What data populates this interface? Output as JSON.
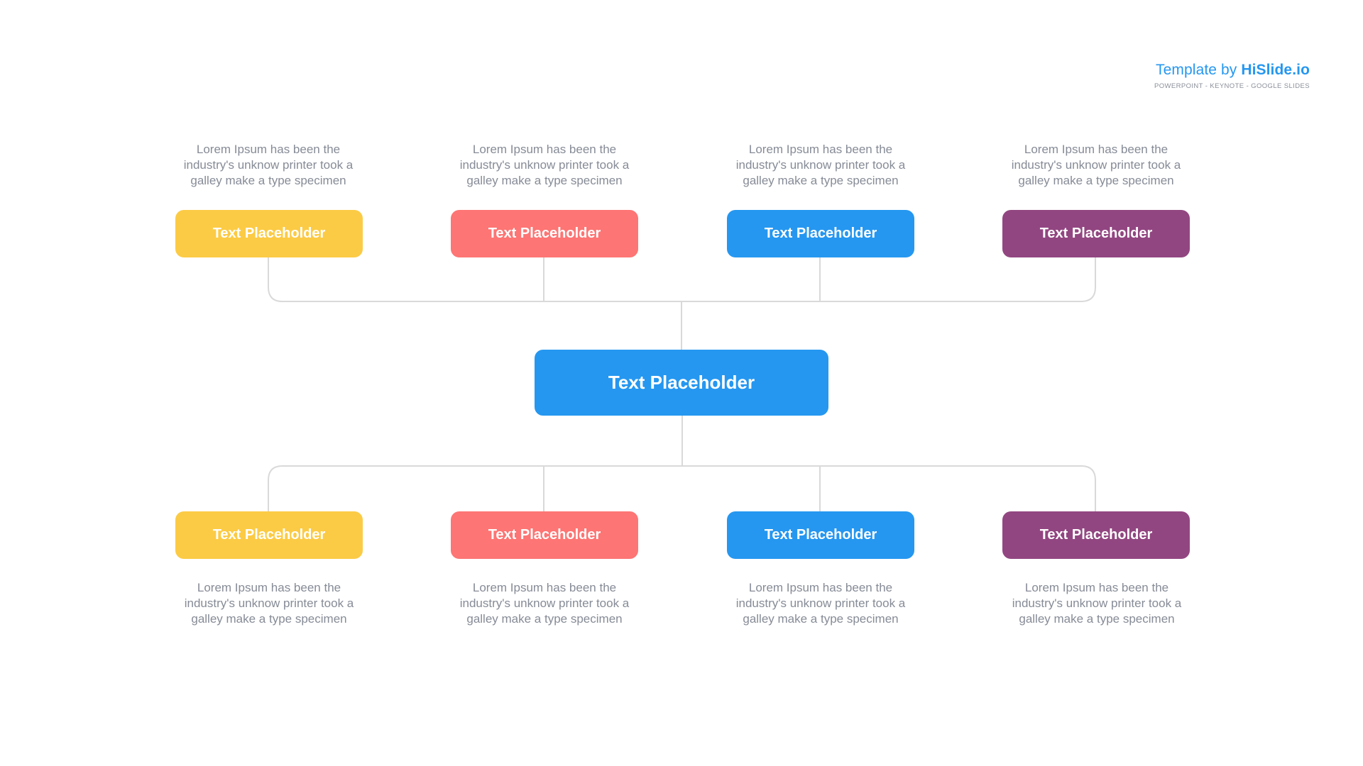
{
  "watermark": {
    "prefix": "Template by ",
    "brand": "HiSlide.io",
    "subtitle": "POWERPOINT - KEYNOTE - GOOGLE SLIDES"
  },
  "colors": {
    "yellow": "#fccb45",
    "coral": "#fd7574",
    "blue": "#2597f0",
    "purple": "#924681",
    "connector": "#d9d9d9",
    "description_text": "#868b96"
  },
  "center_node": {
    "label": "Text Placeholder",
    "color": "#2597f0"
  },
  "top_row": [
    {
      "label": "Text Placeholder",
      "color": "#fccb45",
      "description": [
        "Lorem Ipsum has been the",
        "industry's unknow printer took a",
        "galley make a type specimen"
      ]
    },
    {
      "label": "Text Placeholder",
      "color": "#fd7574",
      "description": [
        "Lorem Ipsum has been the",
        "industry's unknow printer took a",
        "galley make a type specimen"
      ]
    },
    {
      "label": "Text Placeholder",
      "color": "#2597f0",
      "description": [
        "Lorem Ipsum has been the",
        "industry's unknow printer took a",
        "galley make a type specimen"
      ]
    },
    {
      "label": "Text Placeholder",
      "color": "#924681",
      "description": [
        "Lorem Ipsum has been the",
        "industry's unknow printer took a",
        "galley make a type specimen"
      ]
    }
  ],
  "bottom_row": [
    {
      "label": "Text Placeholder",
      "color": "#fccb45",
      "description": [
        "Lorem Ipsum has been the",
        "industry's unknow printer took a",
        "galley make a type specimen"
      ]
    },
    {
      "label": "Text Placeholder",
      "color": "#fd7574",
      "description": [
        "Lorem Ipsum has been the",
        "industry's unknow printer took a",
        "galley make a type specimen"
      ]
    },
    {
      "label": "Text Placeholder",
      "color": "#2597f0",
      "description": [
        "Lorem Ipsum has been the",
        "industry's unknow printer took a",
        "galley make a type specimen"
      ]
    },
    {
      "label": "Text Placeholder",
      "color": "#924681",
      "description": [
        "Lorem Ipsum has been the",
        "industry's unknow printer took a",
        "galley make a type specimen"
      ]
    }
  ]
}
